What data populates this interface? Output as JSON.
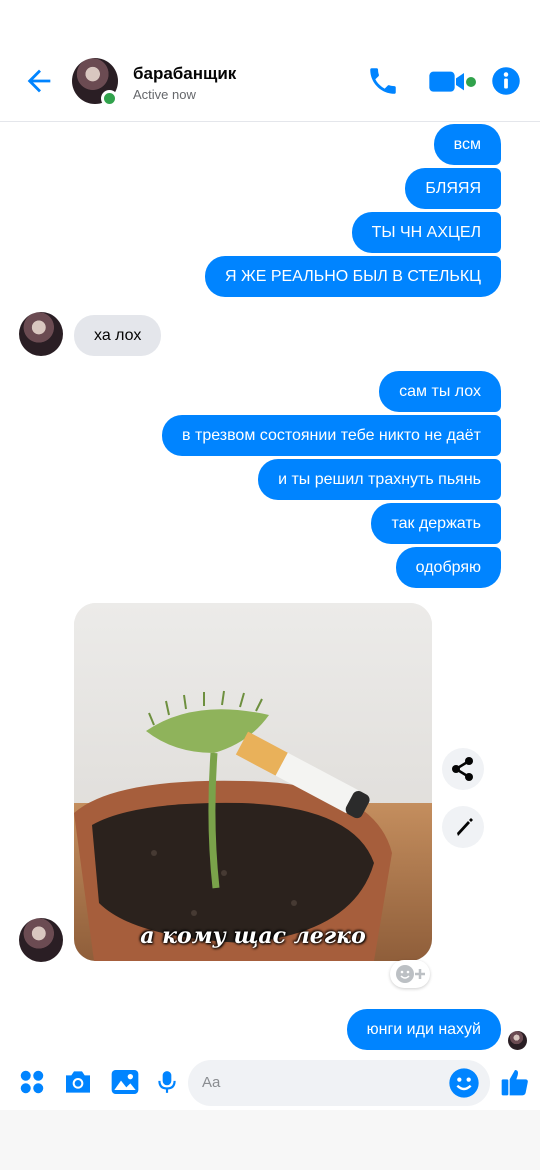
{
  "header": {
    "name": "барабанщик",
    "status": "Active now",
    "icons": [
      "back-arrow-icon",
      "phone-icon",
      "video-camera-icon",
      "info-icon"
    ],
    "accent": "#0084ff",
    "online_color": "#31a24c"
  },
  "messages_top": [
    {
      "text": "всм"
    },
    {
      "text": "БЛЯЯЯ"
    },
    {
      "text": "ТЫ ЧН АХЦЕЛ"
    },
    {
      "text": "Я ЖЕ РЕАЛЬНО БЫЛ В СТЕЛЬКЦ"
    }
  ],
  "incoming_1": {
    "text": "ха лох"
  },
  "messages_mid": [
    {
      "text": "сам ты лох"
    },
    {
      "text": "в трезвом состоянии тебе никто не даёт"
    },
    {
      "text": "и ты решил трахнуть пьянь"
    },
    {
      "text": "так держать"
    },
    {
      "text": "одобряю"
    }
  ],
  "image_message": {
    "caption": "а кому щас легко",
    "actions": [
      "share-icon",
      "edit-pencil-icon"
    ]
  },
  "last_message": {
    "text": "юнги иди нахуй"
  },
  "composer": {
    "placeholder": "Aa",
    "icons": [
      "apps-grid-icon",
      "camera-icon",
      "image-icon",
      "microphone-icon",
      "emoji-icon",
      "thumbs-up-icon"
    ]
  }
}
